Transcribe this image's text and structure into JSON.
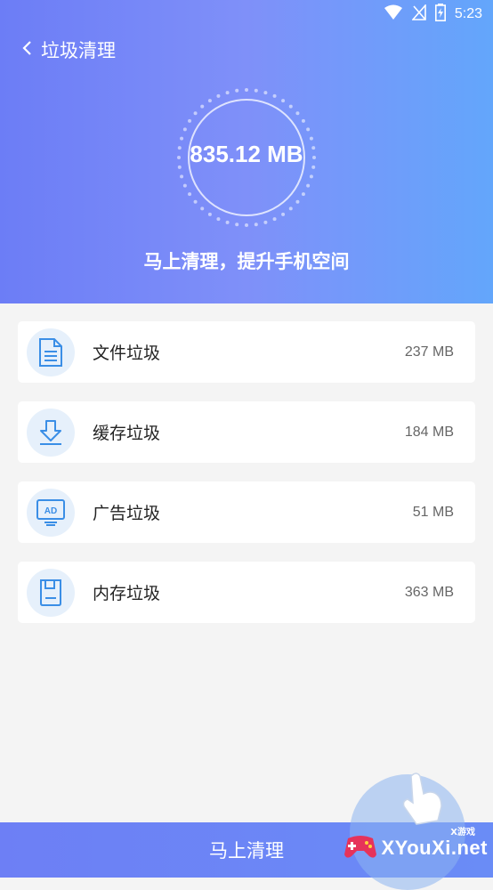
{
  "status_bar": {
    "time": "5:23"
  },
  "header": {
    "title": "垃圾清理",
    "total_size": "835.12 MB",
    "subtitle": "马上清理，提升手机空间"
  },
  "items": [
    {
      "label": "文件垃圾",
      "size": "237 MB",
      "icon": "file-icon"
    },
    {
      "label": "缓存垃圾",
      "size": "184 MB",
      "icon": "download-icon"
    },
    {
      "label": "广告垃圾",
      "size": "51 MB",
      "icon": "ad-icon"
    },
    {
      "label": "内存垃圾",
      "size": "363 MB",
      "icon": "memory-card-icon"
    }
  ],
  "bottom_button": {
    "label": "马上清理"
  },
  "watermark": {
    "brand": "XYouXi.net",
    "tag": "X游戏"
  },
  "colors": {
    "header_start": "#6c7df6",
    "header_end": "#63a6fb",
    "icon_blue": "#3a8ee6",
    "icon_bg": "#e6f0fb"
  }
}
